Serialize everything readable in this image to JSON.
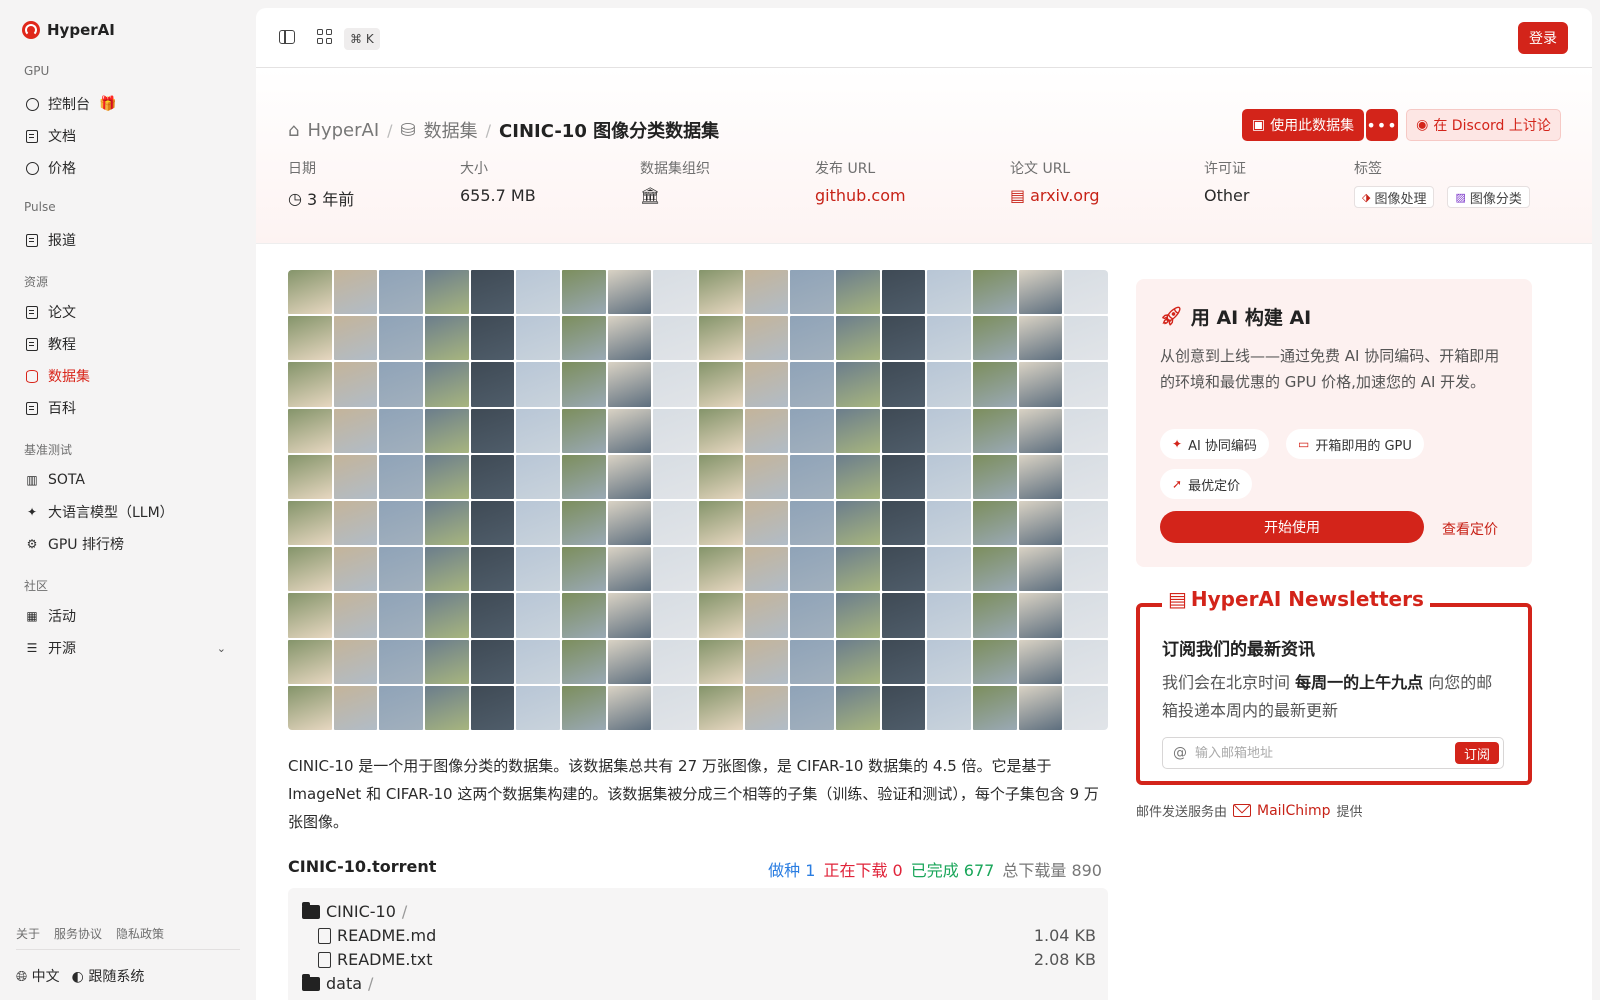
{
  "brand": {
    "name": "HyperAI"
  },
  "sidebar": {
    "groups": [
      {
        "label": "GPU",
        "items": [
          {
            "label": "控制台",
            "icon": "dashboard-icon"
          },
          {
            "label": "文档",
            "icon": "doc-icon"
          },
          {
            "label": "价格",
            "icon": "price-icon"
          }
        ]
      },
      {
        "label": "Pulse",
        "items": [
          {
            "label": "报道",
            "icon": "news-icon"
          }
        ]
      },
      {
        "label": "资源",
        "items": [
          {
            "label": "论文",
            "icon": "paper-icon"
          },
          {
            "label": "教程",
            "icon": "tutorial-icon"
          },
          {
            "label": "数据集",
            "icon": "dataset-icon",
            "active": true
          },
          {
            "label": "百科",
            "icon": "wiki-icon"
          }
        ]
      },
      {
        "label": "基准测试",
        "items": [
          {
            "label": "SOTA",
            "icon": "chart-icon"
          },
          {
            "label": "大语言模型（LLM）",
            "icon": "sparkle-icon"
          },
          {
            "label": "GPU 排行榜",
            "icon": "cpu-icon"
          }
        ]
      },
      {
        "label": "社区",
        "items": [
          {
            "label": "活动",
            "icon": "calendar-icon"
          },
          {
            "label": "开源",
            "icon": "list-icon"
          }
        ]
      }
    ],
    "footer_links": [
      "关于",
      "服务协议",
      "隐私政策"
    ],
    "language": "中文",
    "theme": "跟随系统"
  },
  "topbar": {
    "shortcut": "⌘ K",
    "login": "登录"
  },
  "breadcrumb": {
    "home": "HyperAI",
    "section": "数据集",
    "current": "CINIC-10 图像分类数据集"
  },
  "actions": {
    "use_dataset": "使用此数据集",
    "more": "•••",
    "discord": "在 Discord 上讨论"
  },
  "meta": {
    "date_label": "日期",
    "date_value": "3 年前",
    "size_label": "大小",
    "size_value": "655.7 MB",
    "org_label": "数据集组织",
    "release_label": "发布 URL",
    "release_value": "github.com",
    "paper_label": "论文 URL",
    "paper_value": "arxiv.org",
    "license_label": "许可证",
    "license_value": "Other",
    "tags_label": "标签",
    "tags": [
      "图像处理",
      "图像分类"
    ]
  },
  "description": "CINIC-10 是一个用于图像分类的数据集。该数据集总共有 27 万张图像，是 CIFAR-10 数据集的 4.5 倍。它是基于 ImageNet 和 CIFAR-10 这两个数据集构建的。该数据集被分成三个相等的子集（训练、验证和测试），每个子集包含 9 万张图像。",
  "torrent": {
    "title": "CINIC-10.torrent",
    "seed": "做种 1",
    "downloading": "正在下载 0",
    "completed": "已完成 677",
    "total": "总下载量 890",
    "root": "CINIC-10",
    "root_slash": "/",
    "files": [
      {
        "name": "README.md",
        "size": "1.04 KB"
      },
      {
        "name": "README.txt",
        "size": "2.08 KB"
      }
    ],
    "next_folder": "data",
    "next_slash": "/"
  },
  "ai_card": {
    "title": "用 AI 构建 AI",
    "text": "从创意到上线——通过免费 AI 协同编码、开箱即用的环境和最优惠的 GPU 价格,加速您的 AI 开发。",
    "chips": [
      "AI 协同编码",
      "开箱即用的 GPU",
      "最优定价"
    ],
    "start": "开始使用",
    "pricing": "查看定价"
  },
  "newsletter": {
    "legend": "HyperAI Newsletters",
    "heading": "订阅我们的最新资讯",
    "text_a": "我们会在北京时间 ",
    "text_bold": "每周一的上午九点",
    "text_b": " 向您的邮箱投递本周内的最新更新",
    "placeholder": "输入邮箱地址",
    "subscribe": "订阅"
  },
  "mail_note": {
    "prefix": "邮件发送服务由",
    "brand": "MailChimp",
    "suffix": "提供"
  },
  "colors": {
    "accent": "#d3241a",
    "sidebar_bg": "#f5f4f4"
  }
}
